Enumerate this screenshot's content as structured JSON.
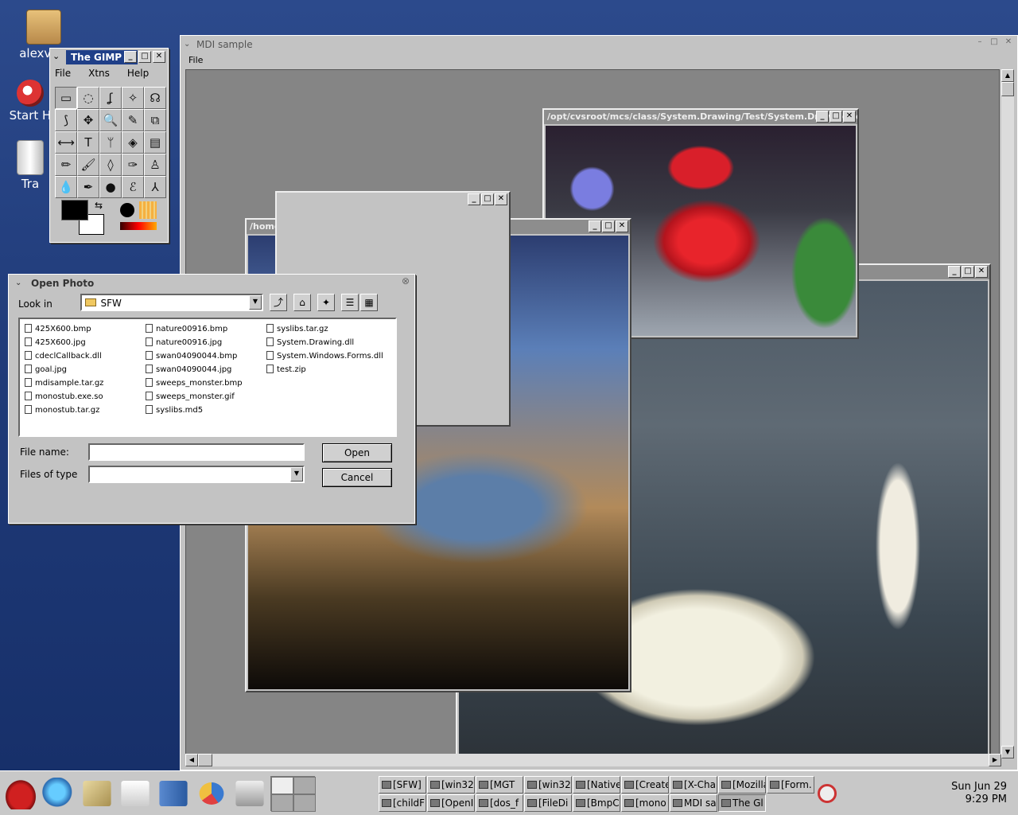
{
  "desktop": {
    "icons": [
      {
        "label": "alexvp's"
      },
      {
        "label": "Start H"
      },
      {
        "label": "Tra"
      }
    ]
  },
  "mdi": {
    "title": "MDI sample",
    "menu": {
      "file": "File"
    },
    "children": {
      "rose_title": "/opt/cvsroot/mcs/class/System.Drawing/Test/System.Drawing/test",
      "lake_title": "/home",
      "swan_title": "",
      "blank_title": ""
    }
  },
  "gimp": {
    "title": "The GIMP",
    "menu": [
      "File",
      "Xtns",
      "Help"
    ],
    "tools": [
      "▭",
      "◌",
      "ʆ",
      "✧",
      "☊",
      "⟆",
      "✥",
      "🔍",
      "✎",
      "⧉",
      "⟷",
      "T",
      "ᛘ",
      "◈",
      "▤",
      "✏",
      "🖌",
      "◊",
      "✑",
      "♙",
      "💧",
      "✒",
      "●",
      "ℰ",
      "⅄"
    ]
  },
  "dialog": {
    "title": "Open Photo",
    "look_in_label": "Look in",
    "look_in_value": "SFW",
    "files_col1": [
      "425X600.bmp",
      "425X600.jpg",
      "cdeclCallback.dll",
      "goal.jpg",
      "mdisample.tar.gz",
      "monostub.exe.so",
      "monostub.tar.gz"
    ],
    "files_col2": [
      "nature00916.bmp",
      "nature00916.jpg",
      "swan04090044.bmp",
      "swan04090044.jpg",
      "sweeps_monster.bmp",
      "sweeps_monster.gif",
      "syslibs.md5"
    ],
    "files_col3": [
      "syslibs.tar.gz",
      "System.Drawing.dll",
      "System.Windows.Forms.dll",
      "test.zip"
    ],
    "file_name_label": "File name:",
    "file_name_value": "",
    "files_of_type_label": "Files of type",
    "files_of_type_value": "",
    "open_label": "Open",
    "cancel_label": "Cancel"
  },
  "taskbar": {
    "tasks_row1": [
      "[SFW]",
      "[win32",
      "[MGT",
      "[win32",
      "[Native",
      "[Create",
      "[X-Cha",
      "[Mozilla",
      "[Form."
    ],
    "tasks_row2": [
      "[childF",
      "[OpenI",
      "[dos_f",
      "[FileDi",
      "[BmpC",
      "[mono",
      "MDI sa",
      "The Gl",
      ""
    ],
    "clock_date": "Sun Jun 29",
    "clock_time": "9:29 PM"
  },
  "colors": {
    "desktop": "#1f3c7a",
    "gimp_title": "#1f3f88",
    "window": "#c3c3c3"
  }
}
